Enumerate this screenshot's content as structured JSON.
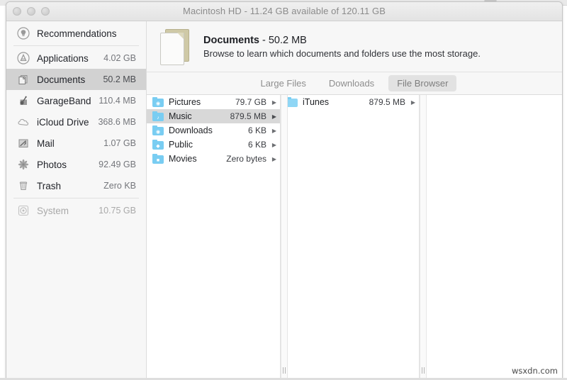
{
  "window": {
    "title": "Macintosh HD - 11.24 GB available of 120.11 GB",
    "traffic_lights": [
      "close",
      "minimize",
      "zoom"
    ]
  },
  "sidebar": {
    "items": [
      {
        "label": "Recommendations",
        "size": "",
        "icon": "lightbulb-icon",
        "state": "normal"
      },
      {
        "label": "Applications",
        "size": "4.02 GB",
        "icon": "app-store-icon",
        "state": "normal"
      },
      {
        "label": "Documents",
        "size": "50.2 MB",
        "icon": "documents-icon",
        "state": "selected"
      },
      {
        "label": "GarageBand",
        "size": "110.4 MB",
        "icon": "garageband-icon",
        "state": "normal"
      },
      {
        "label": "iCloud Drive",
        "size": "368.6 MB",
        "icon": "cloud-icon",
        "state": "normal"
      },
      {
        "label": "Mail",
        "size": "1.07 GB",
        "icon": "mail-stamp-icon",
        "state": "normal"
      },
      {
        "label": "Photos",
        "size": "92.49 GB",
        "icon": "photos-flower-icon",
        "state": "normal"
      },
      {
        "label": "Trash",
        "size": "Zero KB",
        "icon": "trash-icon",
        "state": "normal"
      },
      {
        "label": "System",
        "size": "10.75 GB",
        "icon": "system-disc-icon",
        "state": "disabled"
      }
    ]
  },
  "category_header": {
    "icon": "document-pages-icon",
    "title_name": "Documents",
    "title_size": " - 50.2 MB",
    "subtitle": "Browse to learn which documents and folders use the most storage."
  },
  "tabs": [
    {
      "label": "Large Files",
      "active": false
    },
    {
      "label": "Downloads",
      "active": false
    },
    {
      "label": "File Browser",
      "active": true
    }
  ],
  "browser": {
    "column1": [
      {
        "name": "Pictures",
        "size": "79.7 GB",
        "icon": "folder-pictures-icon",
        "glyph": "◉",
        "selected": false,
        "arrow": "▶"
      },
      {
        "name": "Music",
        "size": "879.5 MB",
        "icon": "folder-music-icon",
        "glyph": "♪",
        "selected": true,
        "arrow": "▶"
      },
      {
        "name": "Downloads",
        "size": "6 KB",
        "icon": "folder-downloads-icon",
        "glyph": "◉",
        "selected": false,
        "arrow": "▶"
      },
      {
        "name": "Public",
        "size": "6 KB",
        "icon": "folder-public-icon",
        "glyph": "◆",
        "selected": false,
        "arrow": "▶"
      },
      {
        "name": "Movies",
        "size": "Zero bytes",
        "icon": "folder-movies-icon",
        "glyph": "■",
        "selected": false,
        "arrow": "▶"
      }
    ],
    "column2": [
      {
        "name": "iTunes",
        "size": "879.5 MB",
        "icon": "folder-icon",
        "glyph": "",
        "selected": false,
        "arrow": "▶"
      }
    ],
    "column3": []
  },
  "watermark": "wsxdn.com"
}
